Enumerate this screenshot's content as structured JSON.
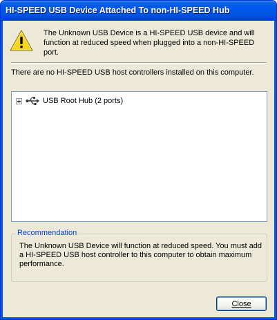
{
  "window": {
    "title": "HI-SPEED USB Device Attached To non-HI-SPEED Hub"
  },
  "message": {
    "text": "The Unknown USB Device is a HI-SPEED USB device and will function at reduced speed when plugged into a non-HI-SPEED port.",
    "icon": "warning-icon"
  },
  "info": {
    "text": "There are no HI-SPEED USB host controllers installed on this computer."
  },
  "tree": {
    "items": [
      {
        "label": "USB Root Hub (2 ports)",
        "expanded": false,
        "icon": "usb-icon"
      }
    ]
  },
  "recommendation": {
    "title": "Recommendation",
    "text": "The Unknown USB Device will function at reduced speed. You must add a HI-SPEED USB host controller to this computer to obtain maximum performance."
  },
  "buttons": {
    "close_label": "Close"
  },
  "colors": {
    "titlebar": "#0054e3",
    "window_bg": "#ece9d8",
    "group_title": "#0046d5"
  }
}
